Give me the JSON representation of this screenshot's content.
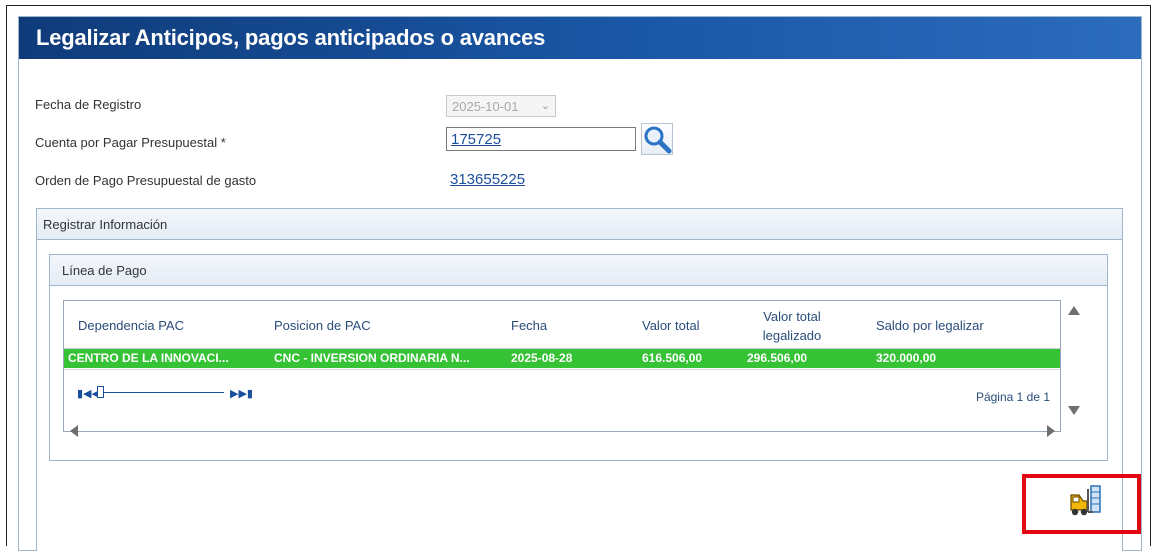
{
  "header": {
    "title": "Legalizar Anticipos, pagos anticipados o avances"
  },
  "form": {
    "fecha_registro": {
      "label": "Fecha de Registro",
      "value": "2025-10-01"
    },
    "cuenta_por_pagar": {
      "label": "Cuenta por Pagar Presupuestal *",
      "value": "175725"
    },
    "orden_pago": {
      "label": "Orden de Pago Presupuestal de gasto",
      "value": "313655225"
    }
  },
  "registrar": {
    "legend": "Registrar Información"
  },
  "linea_pago": {
    "legend": "Línea de Pago",
    "columns": [
      "Dependencia PAC",
      "Posicion de PAC",
      "Fecha",
      "Valor total",
      "Valor total legalizado",
      "Saldo por legalizar"
    ],
    "rows": [
      [
        "CENTRO DE LA INNOVACI...",
        "CNC - INVERSION ORDINARIA N...",
        "2025-08-28",
        "616.506,00",
        "296.506,00",
        "320.000,00"
      ]
    ],
    "page_info": "Página 1 de 1"
  },
  "colors": {
    "header_bg": "#1a57a6",
    "selected_row": "#35c235",
    "highlight": "#e30613",
    "link": "#1a4f9c"
  },
  "icons": {
    "search": "magnifier-icon",
    "action": "forklift-icon",
    "pager": "pager-icons"
  }
}
